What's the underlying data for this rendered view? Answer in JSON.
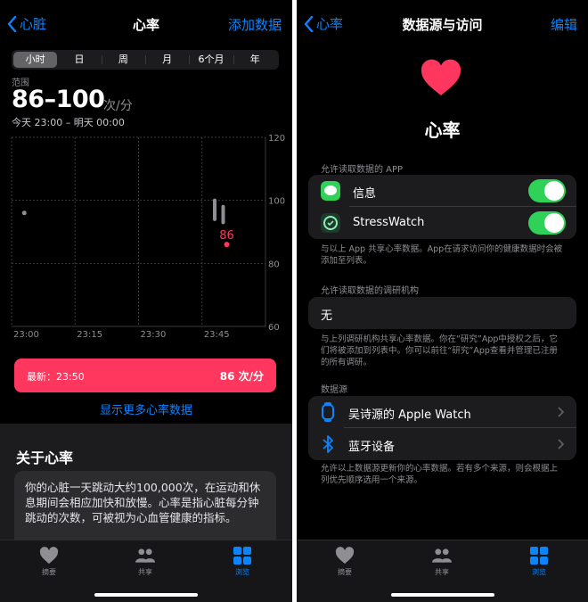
{
  "left": {
    "nav": {
      "back_label": "心脏",
      "title": "心率",
      "action": "添加数据"
    },
    "segments": [
      "小时",
      "日",
      "周",
      "月",
      "6个月",
      "年"
    ],
    "active_segment": "小时",
    "summary": {
      "range_label": "范围",
      "range_value": "86–100",
      "unit": "次/分",
      "time_range": "今天 23:00 – 明天 00:00"
    },
    "chart_data": {
      "type": "scatter",
      "x_ticks": [
        "23:00",
        "23:15",
        "23:30",
        "23:45"
      ],
      "y_ticks": [
        120,
        100,
        80,
        60
      ],
      "ylim": [
        60,
        120
      ],
      "xlim_minutes": [
        0,
        60
      ],
      "grid": true,
      "points": [
        {
          "time": "23:03",
          "min": 96,
          "max": 96,
          "highlight": false
        },
        {
          "time": "23:48",
          "min": 94,
          "max": 100,
          "highlight": false
        },
        {
          "time": "23:50",
          "min": 93,
          "max": 98,
          "highlight": false
        },
        {
          "time": "23:50",
          "min": 86,
          "max": 86,
          "highlight": true
        }
      ],
      "highlight_label": "86",
      "highlight_color": "#ff375f"
    },
    "latest": {
      "label": "最新：23:50",
      "value": "86 次/分"
    },
    "more_link": "显示更多心率数据",
    "about": {
      "title": "关于心率",
      "text": "你的心脏一天跳动大约100,000次，在运动和休息期间会相应加快和放慢。心率是指心脏每分钟跳动的次数，可被视为心血管健康的指标。"
    },
    "tabs": [
      {
        "label": "摘要",
        "icon": "heart-icon",
        "active": false
      },
      {
        "label": "共享",
        "icon": "people-icon",
        "active": false
      },
      {
        "label": "浏览",
        "icon": "grid-icon",
        "active": true
      }
    ]
  },
  "right": {
    "nav": {
      "back_label": "心率",
      "title": "数据源与访问",
      "action": "编辑"
    },
    "title": "心率",
    "apps_header": "允许读取数据的 APP",
    "apps": [
      {
        "name": "信息",
        "icon": "messages-icon",
        "enabled": true
      },
      {
        "name": "StressWatch",
        "icon": "stresswatch-icon",
        "enabled": true
      }
    ],
    "apps_note": "与以上 App 共享心率数据。App在请求访问你的健康数据时会被添加至列表。",
    "research_header": "允许读取数据的调研机构",
    "research_value": "无",
    "research_note": "与上列调研机构共享心率数据。你在“研究”App中授权之后，它们将被添加到列表中。你可以前往“研究”App查看并管理已注册的所有调研。",
    "sources_header": "数据源",
    "sources": [
      {
        "name": "吴诗源的 Apple Watch",
        "icon": "watch-icon"
      },
      {
        "name": "蓝牙设备",
        "icon": "bluetooth-icon"
      }
    ],
    "sources_note": "允许以上数据源更新你的心率数据。若有多个来源，则会根据上列优先顺序选用一个来源。",
    "tabs": [
      {
        "label": "摘要",
        "icon": "heart-icon",
        "active": false
      },
      {
        "label": "共享",
        "icon": "people-icon",
        "active": false
      },
      {
        "label": "浏览",
        "icon": "grid-icon",
        "active": true
      }
    ]
  },
  "colors": {
    "accent": "#0a84ff",
    "heart": "#ff375f",
    "toggle_on": "#30d158"
  }
}
